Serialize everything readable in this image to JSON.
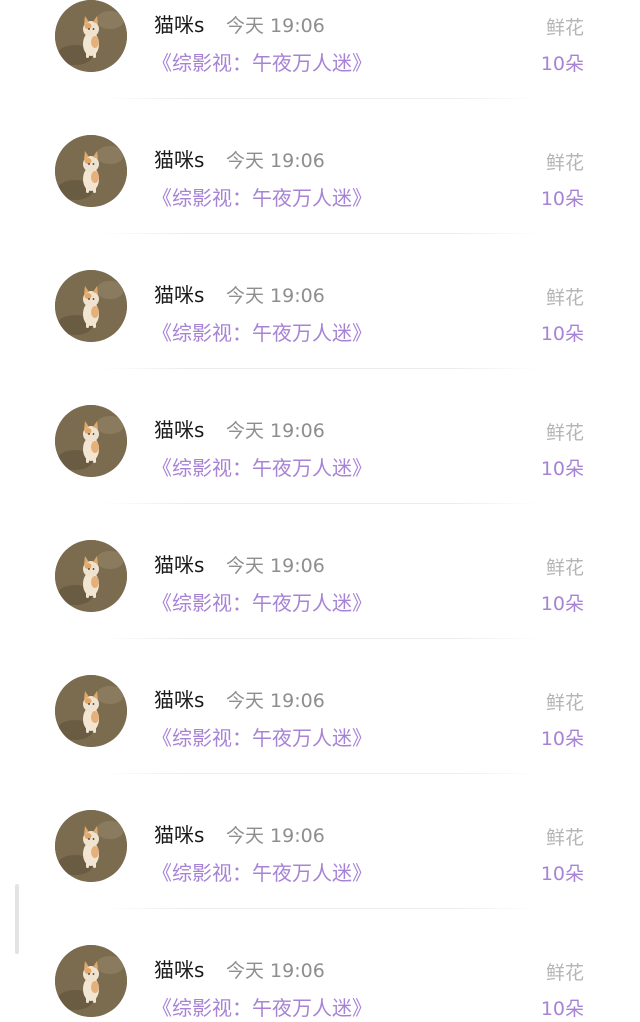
{
  "records": [
    {
      "username": "猫咪s",
      "timestamp": "今天 19:06",
      "book_title": "《综影视：午夜万人迷》",
      "gift_type": "鲜花",
      "gift_count": "10朵"
    },
    {
      "username": "猫咪s",
      "timestamp": "今天 19:06",
      "book_title": "《综影视：午夜万人迷》",
      "gift_type": "鲜花",
      "gift_count": "10朵"
    },
    {
      "username": "猫咪s",
      "timestamp": "今天 19:06",
      "book_title": "《综影视：午夜万人迷》",
      "gift_type": "鲜花",
      "gift_count": "10朵"
    },
    {
      "username": "猫咪s",
      "timestamp": "今天 19:06",
      "book_title": "《综影视：午夜万人迷》",
      "gift_type": "鲜花",
      "gift_count": "10朵"
    },
    {
      "username": "猫咪s",
      "timestamp": "今天 19:06",
      "book_title": "《综影视：午夜万人迷》",
      "gift_type": "鲜花",
      "gift_count": "10朵"
    },
    {
      "username": "猫咪s",
      "timestamp": "今天 19:06",
      "book_title": "《综影视：午夜万人迷》",
      "gift_type": "鲜花",
      "gift_count": "10朵"
    },
    {
      "username": "猫咪s",
      "timestamp": "今天 19:06",
      "book_title": "《综影视：午夜万人迷》",
      "gift_type": "鲜花",
      "gift_count": "10朵"
    },
    {
      "username": "猫咪s",
      "timestamp": "今天 19:06",
      "book_title": "《综影视：午夜万人迷》",
      "gift_type": "鲜花",
      "gift_count": "10朵"
    }
  ],
  "colors": {
    "accent_purple": "#a783d6",
    "username_text": "#1a1a1a",
    "timestamp_text": "#8e8e8e",
    "gift_type_text": "#b5b5b5"
  },
  "icons": {
    "avatar": "cat-avatar-icon"
  }
}
